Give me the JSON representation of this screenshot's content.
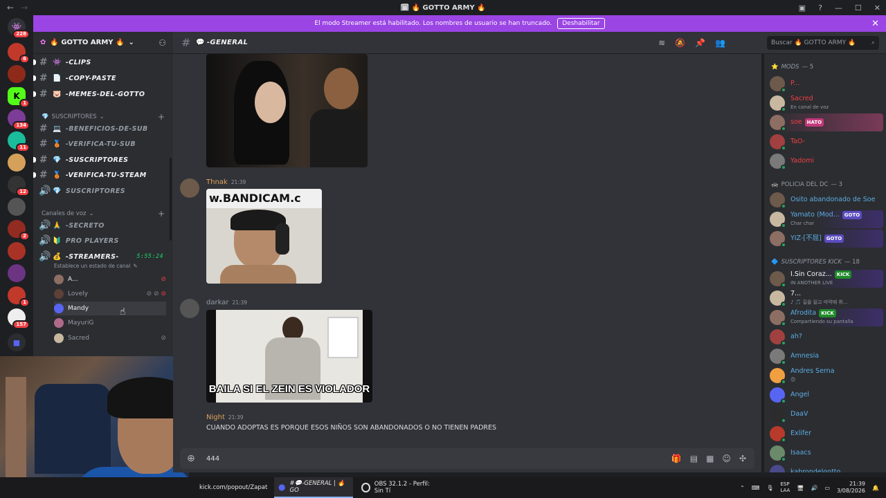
{
  "window": {
    "title": "🗓 🔥 GOTTO ARMY 🔥"
  },
  "banner": {
    "text": "El modo Streamer está habilitado. Los nombres de usuario se han truncado.",
    "button": "Deshabilitar"
  },
  "guilds": {
    "badges": [
      "228",
      "6",
      "1",
      "134",
      "11",
      "12",
      "2",
      "1",
      "1",
      "157"
    ]
  },
  "server": {
    "name": "🔥 GOTTO ARMY 🔥"
  },
  "channels": {
    "clips": "-CLIPS",
    "copy_paste": "-COPY-PASTE",
    "memes": "-MEMES-DEL-GOTTO",
    "cat_suscriptores": "SUSCRIPTORES",
    "beneficios": "-BENEFICIOS-DE-SUB",
    "verifica_sub": "-VERIFICA-TU-SUB",
    "suscriptores": "-SUSCRIPTORES",
    "verifica_steam": "-VERIFICA-TU-STEAM",
    "suscriptores_voice": "SUSCRIPTORES",
    "cat_voz": "Canales de voz",
    "secreto": "-SECRETO",
    "pro_players": "PRO PLAYERS",
    "streamers": "-STREAMERS-",
    "streamers_time": "5:55:24",
    "streamers_status": "Establece un estado de canal"
  },
  "voice_users": [
    "A...",
    "Lovely",
    "Mandy",
    "MayuriG",
    "Sacred"
  ],
  "chat": {
    "channel": "-GENERAL",
    "search_placeholder": "Buscar 🔥 GOTTO ARMY 🔥",
    "composer_value": "444"
  },
  "messages": [
    {
      "author": "Thnak",
      "time": "21:39",
      "color": "#e0a35a"
    },
    {
      "author": "darkar",
      "time": "21:39",
      "color": "#949ba4"
    },
    {
      "author": "Night",
      "time": "21:39",
      "color": "#e0a35a",
      "text": "CUANDO ADOPTAS ES PORQUE ESOS NIÑOS SON ABANDONADOS O NO TIENEN PADRES"
    }
  ],
  "gif_texts": {
    "bandicam": "w.BANDICAM.c",
    "caption": "BAILA SI EL ZEIN ES VIOLADOR"
  },
  "members": {
    "mods_label": "MODS",
    "mods_count": "— 5",
    "mods": [
      {
        "name": "P...",
        "color": "#f23f43",
        "sub": ""
      },
      {
        "name": "Sacred",
        "color": "#f23f43",
        "sub": "En canal de voz"
      },
      {
        "name": "soe",
        "color": "#f23f43",
        "tag": "HATO"
      },
      {
        "name": "TaO-",
        "color": "#f23f43"
      },
      {
        "name": "Yadomi",
        "color": "#f23f43"
      }
    ],
    "policia_label": "POLICIA DEL DC",
    "policia_count": "— 3",
    "policia": [
      {
        "name": "Osito abandonado de Soe",
        "color": "#5dade2"
      },
      {
        "name": "Yamato (Mod...",
        "color": "#5dade2",
        "tag": "GOTO",
        "sub": "Char char"
      },
      {
        "name": "YIZ-[不屈]",
        "color": "#5dade2",
        "tag": "GOTO"
      }
    ],
    "kick_label": "SUSCRIPTORES KICK",
    "kick_count": "— 18",
    "kick": [
      {
        "name": "I.Sin Coraz...",
        "color": "#f2f3f5",
        "tag": "KICK",
        "sub": "IN ANOTHER LIVE"
      },
      {
        "name": "7...",
        "color": "#f2f3f5",
        "sub": "♪ 🎵 길을 잃고 마약에 취..."
      },
      {
        "name": "Afrodita",
        "color": "#5dade2",
        "tag": "KICK",
        "sub": "Compartiendo su pantalla"
      },
      {
        "name": "ah?",
        "color": "#5dade2"
      },
      {
        "name": "Amnesia",
        "color": "#5dade2"
      },
      {
        "name": "Andres Serna",
        "color": "#5dade2",
        "sub": "😊"
      },
      {
        "name": "Angel",
        "color": "#5dade2"
      },
      {
        "name": "DaaV",
        "color": "#5dade2"
      },
      {
        "name": "Exlifer",
        "color": "#5dade2"
      },
      {
        "name": "Isaacs",
        "color": "#5dade2"
      },
      {
        "name": "kabrondelgotto",
        "color": "#5dade2"
      }
    ]
  },
  "taskbar": {
    "chrome": "kick.com/popout/Zapat",
    "discord": "#💬-GENERAL | 🔥 GO",
    "obs": "OBS 32.1.2 - Perfil: Sin Tí",
    "lang1": "ESP",
    "lang2": "LAA",
    "time": "21:39",
    "date": "3/08/2026"
  }
}
